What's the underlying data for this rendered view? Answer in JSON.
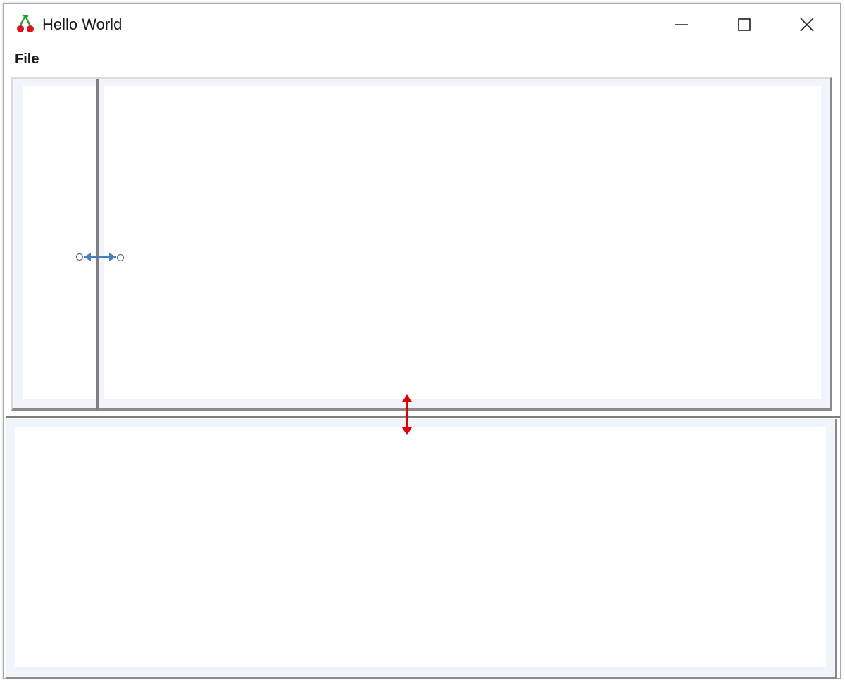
{
  "window": {
    "title": "Hello World",
    "app_icon": "cherry-icon",
    "controls": {
      "minimize": "minimize-icon",
      "maximize": "maximize-icon",
      "close": "close-icon"
    }
  },
  "menubar": {
    "items": [
      {
        "label": "File"
      }
    ]
  },
  "annotations": {
    "horizontal_resize_arrow": {
      "icon": "double-arrow-horizontal-icon",
      "color": "#4a7fc1"
    },
    "vertical_resize_arrow": {
      "icon": "double-arrow-vertical-icon",
      "color": "#e00000"
    }
  },
  "colors": {
    "pane_background": "#ffffff",
    "frame_background": "#f1f4fa",
    "splitter": "#7e7e7e"
  }
}
